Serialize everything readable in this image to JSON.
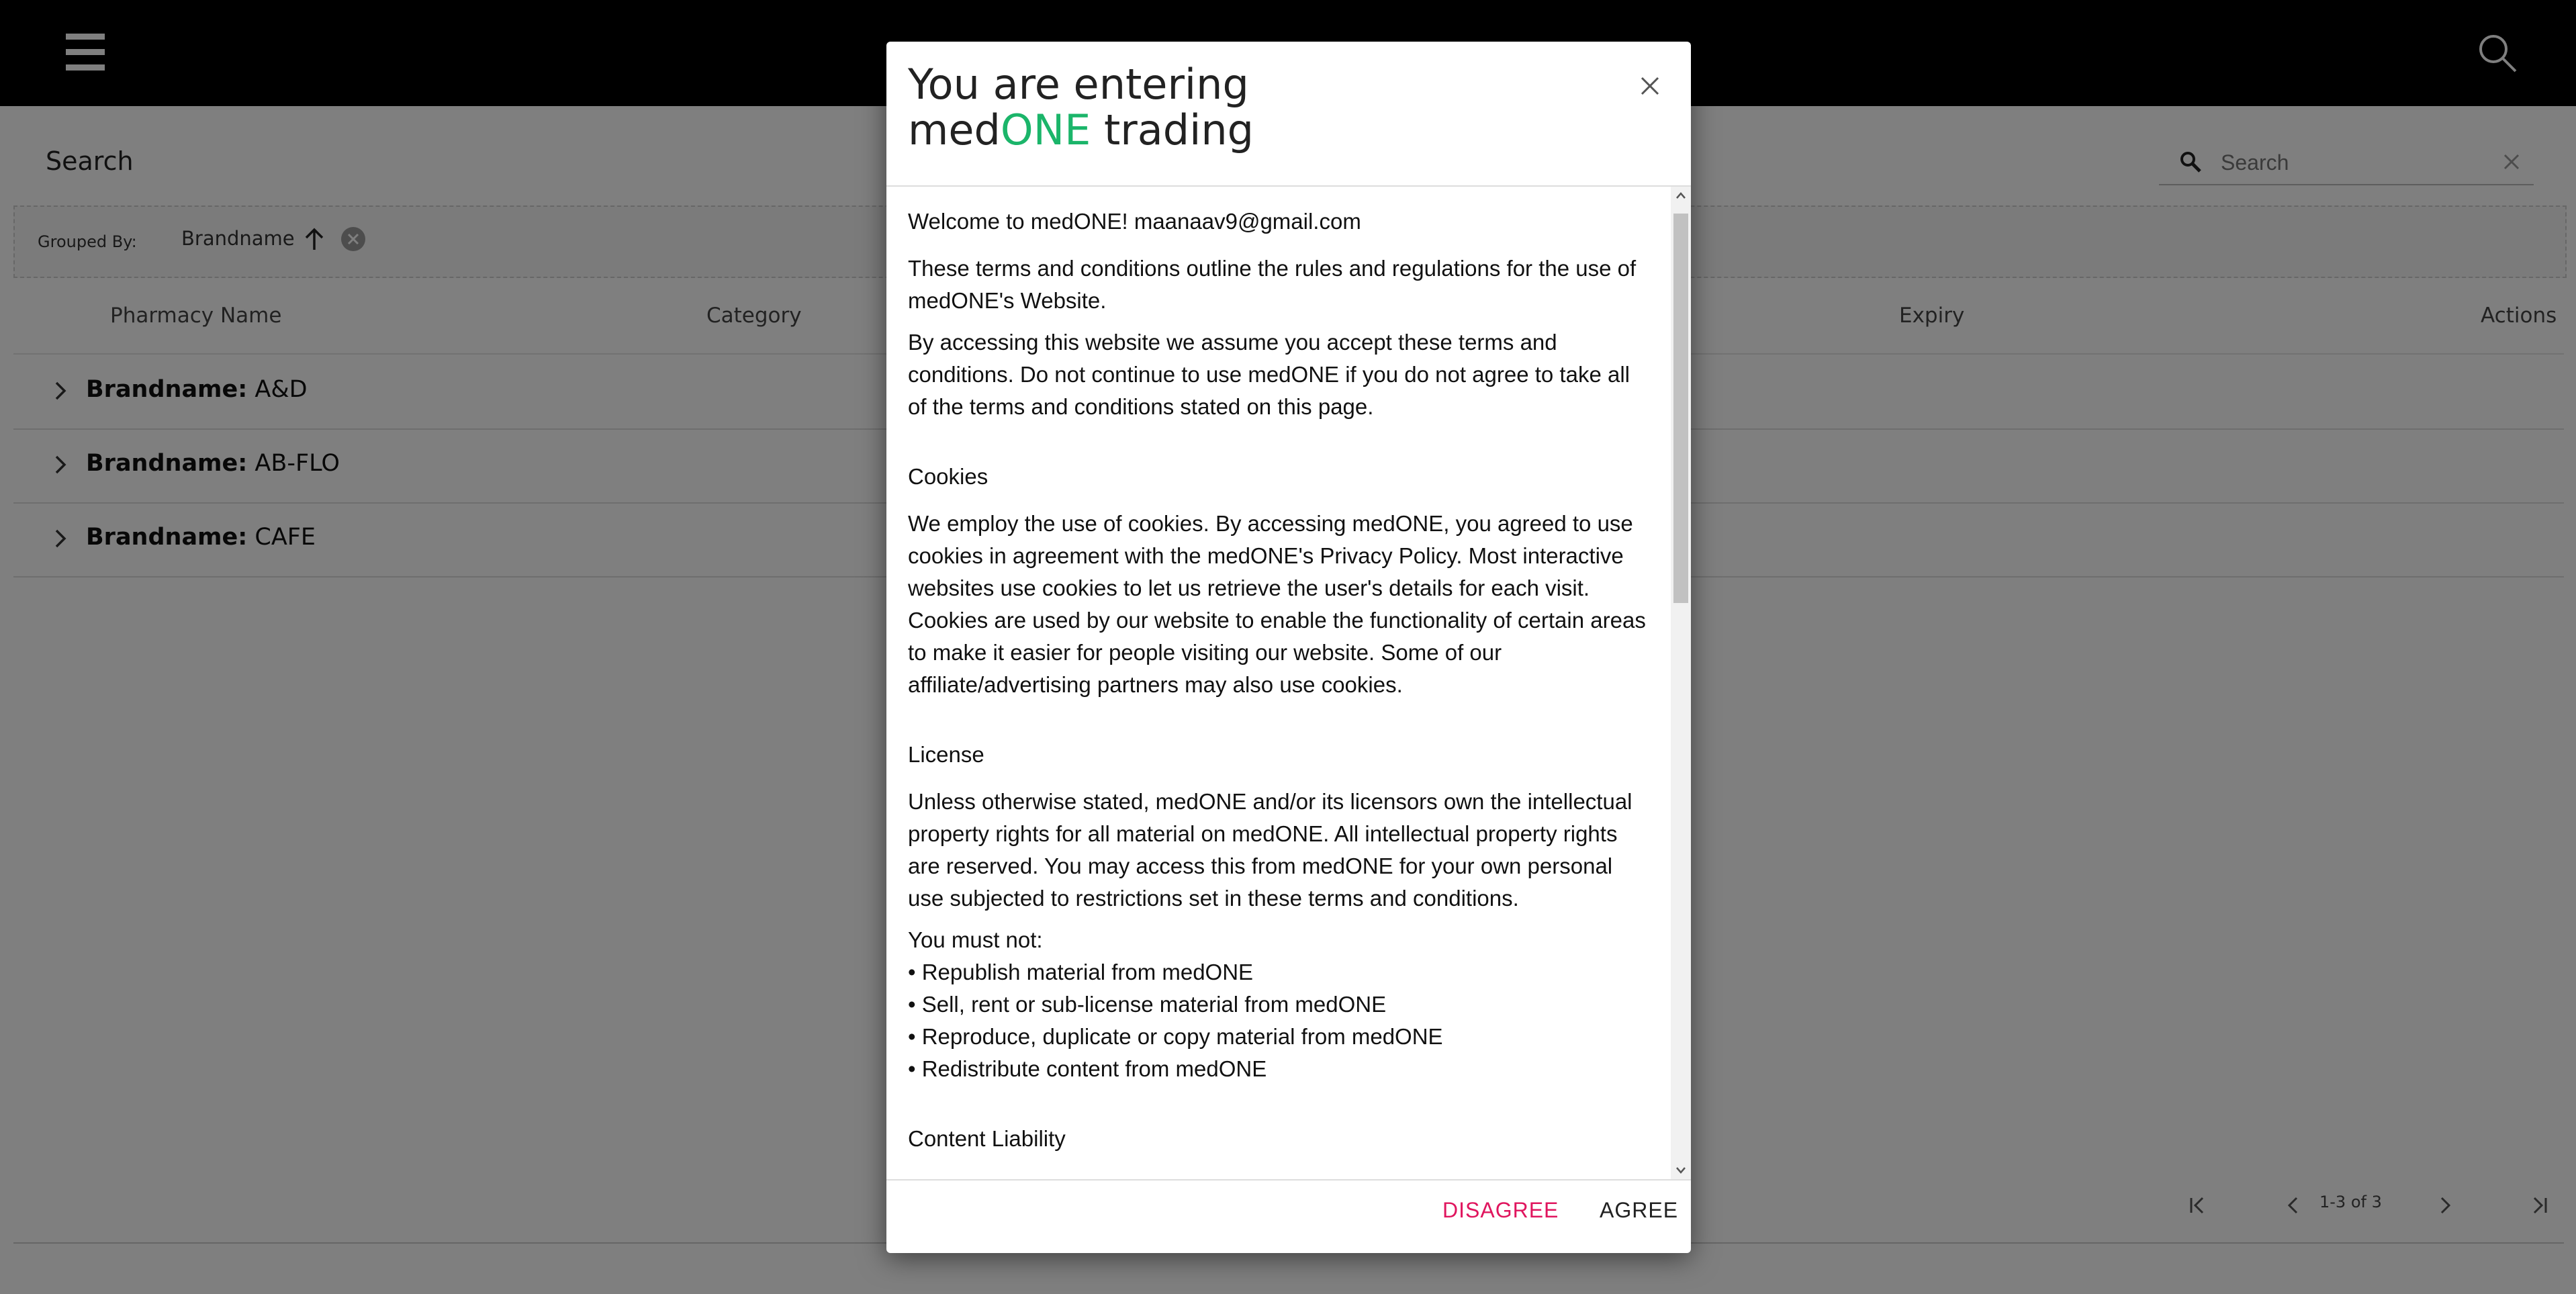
{
  "header": {
    "menu_icon": "hamburger-icon",
    "search_icon": "search-icon"
  },
  "page": {
    "title": "Search",
    "search": {
      "placeholder": "Search",
      "value": ""
    },
    "grouping": {
      "label": "Grouped By:",
      "field": "Brandname",
      "sort_icon": "arrow-up-icon",
      "remove_icon": "close-circle-icon"
    },
    "columns": [
      "Pharmacy Name",
      "Category",
      "Expiry",
      "Actions"
    ],
    "groups": [
      {
        "label": "Brandname:",
        "value": "A&D"
      },
      {
        "label": "Brandname:",
        "value": "AB-FLO"
      },
      {
        "label": "Brandname:",
        "value": "CAFE"
      }
    ],
    "pagination": {
      "range": "1-3 of 3"
    }
  },
  "modal": {
    "title_line1": "You are entering",
    "title_prefix": "med",
    "title_accent": "ONE",
    "title_suffix": " trading",
    "accent_color": "#1bb56a",
    "welcome": "Welcome to medONE! maanaav9@gmail.com",
    "intro1": "These terms and conditions outline the rules and regulations for the use of medONE's Website.",
    "intro2": "By accessing this website we assume you accept these terms and conditions. Do not continue to use medONE if you do not agree to take all of the terms and conditions stated on this page.",
    "cookies_heading": "Cookies",
    "cookies_text": "We employ the use of cookies. By accessing medONE, you agreed to use cookies in agreement with the medONE's Privacy Policy. Most interactive websites use cookies to let us retrieve the user's details for each visit. Cookies are used by our website to enable the functionality of certain areas to make it easier for people visiting our website. Some of our affiliate/advertising partners may also use cookies.",
    "license_heading": "License",
    "license_text": "Unless otherwise stated, medONE and/or its licensors own the intellectual property rights for all material on medONE. All intellectual property rights are reserved. You may access this from medONE for your own personal use subjected to restrictions set in these terms and conditions.",
    "must_not": "You must not:",
    "must_not_items": [
      "• Republish material from medONE",
      "• Sell, rent or sub-license material from medONE",
      "• Reproduce, duplicate or copy material from medONE",
      "• Redistribute content from medONE"
    ],
    "liability_heading": "Content Liability",
    "disagree_label": "DISAGREE",
    "agree_label": "AGREE",
    "disagree_color": "#e0155e"
  }
}
